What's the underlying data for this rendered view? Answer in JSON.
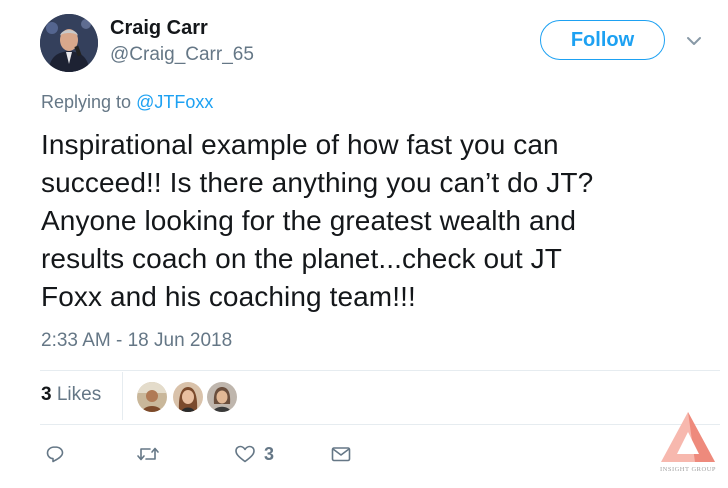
{
  "user": {
    "name": "Craig Carr",
    "handle": "@Craig_Carr_65"
  },
  "follow_label": "Follow",
  "reply": {
    "prefix": "Replying to ",
    "mention": "@JTFoxx"
  },
  "tweet": {
    "lines": [
      "Inspirational example of how fast you can",
      "succeed!! Is there anything you can’t do JT?",
      "Anyone looking for the greatest wealth and",
      "results coach on the planet...check out JT",
      "Foxx and his coaching team!!!"
    ]
  },
  "timestamp": "2:33 AM - 18 Jun 2018",
  "likes": {
    "count": "3",
    "label": "Likes"
  },
  "actions": {
    "reply_icon": "reply-icon",
    "retweet_icon": "retweet-icon",
    "like_icon": "heart-icon",
    "like_count": "3",
    "dm_icon": "envelope-icon"
  },
  "watermark": {
    "text": "INSIGHT GROUP"
  },
  "colors": {
    "accent": "#1da1f2",
    "secondary_text": "#657786",
    "primary_text": "#14171a",
    "divider": "#e6ecf0",
    "watermark": "#f29a8e"
  }
}
